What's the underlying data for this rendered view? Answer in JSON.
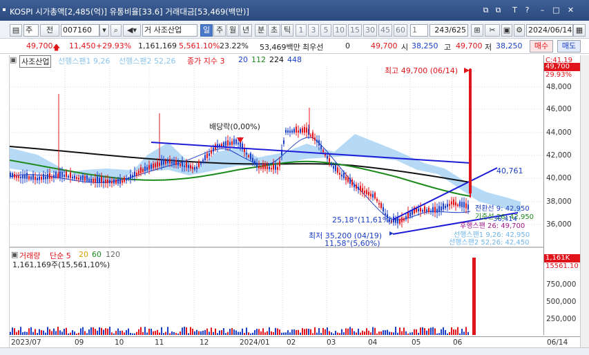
{
  "window": {
    "title": "KOSPI 시가총액[2,485(억)] 유통비율[33.6] 거래대금[53,469(백만)]",
    "controls": [
      "⧉",
      "⧉",
      "T",
      "?",
      "–",
      "□",
      "✕"
    ]
  },
  "toolbar": {
    "period_label": "주",
    "type_label": "전",
    "code": "007160",
    "stock_name": "거 사조산업",
    "periods": [
      "일",
      "주",
      "월",
      "년",
      "분",
      "초",
      "틱"
    ],
    "selected_period": "일",
    "intervals": [
      "1",
      "3",
      "5",
      "10",
      "15",
      "30",
      "45",
      "60"
    ],
    "unit_value": "1",
    "page_counter": "243/625",
    "date": "2024/06/14"
  },
  "quote": {
    "price": "49,700",
    "change": "11,450",
    "change_pct": "+29.93%",
    "volume": "1,161,169",
    "volume_pct": "5,561.10%",
    "turnover_rate": "23.22%",
    "trade_value": "53,469백만",
    "best_label": "최우선",
    "best_value": "0",
    "price2": "49,700",
    "open_label": "시",
    "open": "38,250",
    "high_label": "고",
    "high": "49,700",
    "low_label": "저",
    "low": "38,250",
    "buy_button": "매수",
    "sell_button": "매도"
  },
  "legend": {
    "stock": "사조산업",
    "span1": "선행스팬1 9,26",
    "span2": "선행스팬2 52,26",
    "ma_label": "종가 지수 3",
    "ma20": "20",
    "ma112": "112",
    "ma224": "224",
    "ma448": "448"
  },
  "annotations": {
    "high": "최고 49,700 (06/14)",
    "dividend": "배당락(0,00%)",
    "low": "최저 35,200 (04/19)",
    "angle1": "25,18°(11,61%)",
    "angle2": "11,58°(5,60%)",
    "trend_value": "40,761",
    "pivot1": "전환선 9: 42,950",
    "pivot2": "기준선 26: 42,950",
    "pivot3": "36,414",
    "pivot4": "후행스팬 26: 49,700",
    "pivot5": "선행스팬1 9,26: 42,950",
    "pivot6": "선행스팬2 52,26: 42,450"
  },
  "price_axis": {
    "labels": [
      "48,000",
      "46,000",
      "44,000",
      "42,000",
      "40,000",
      "38,000",
      "36,000"
    ],
    "top_tag1": "C:41.19",
    "top_tag2": "49,700",
    "top_tag3": "29.93%"
  },
  "volume_panel": {
    "legend_title": "거래량",
    "legend_ma": "단순 5",
    "ma20": "20",
    "ma60": "60",
    "ma120": "120",
    "info": "1,161,169주(15,561,10%)",
    "axis": [
      "750,000",
      "500,000",
      "250,000"
    ],
    "tag1": "1,161K",
    "tag2": "15561.10"
  },
  "x_axis": {
    "labels": [
      "2023/07",
      "09",
      "10",
      "11",
      "12",
      "2024/01",
      "02",
      "03",
      "04",
      "05",
      "06",
      "06/14"
    ]
  },
  "colors": {
    "up": "#e0141a",
    "down": "#1b3fc4",
    "cloud": "#a9d4f5",
    "ma_long": "#111111",
    "ma_mid": "#1b8a1b",
    "trend": "#1c1cd6"
  }
}
